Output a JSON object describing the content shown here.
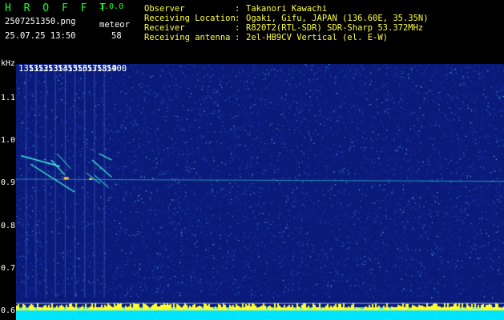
{
  "app": {
    "name": "H R O F F T",
    "version": "1.0.0"
  },
  "file": {
    "name": "2507251350.png",
    "datetime": "25.07.25 13:50"
  },
  "meteor": {
    "label": "meteor",
    "count": "58"
  },
  "info": [
    {
      "key": "Observer",
      "sep": ":",
      "value": "Takanori Kawachi"
    },
    {
      "key": "Receiving Location",
      "sep": ":",
      "value": "Ogaki, Gifu, JAPAN (136.60E, 35.35N)"
    },
    {
      "key": "Receiver",
      "sep": ":",
      "value": "R820T2(RTL-SDR) SDR-Sharp 53.372MHz"
    },
    {
      "key": "Receiving antenna",
      "sep": ":",
      "value": "2el-HB9CV Vertical (el. E-W)"
    }
  ],
  "chart_data": {
    "type": "heatmap",
    "ylabel": "kHz",
    "y_ticks": [
      "1.1",
      "1.0",
      "0.9",
      "0.8",
      "0.7",
      "0.6"
    ],
    "x_ticks": [
      "1351",
      "1352",
      "1353",
      "1354",
      "1355",
      "1356",
      "1357",
      "1358",
      "1359",
      "1400"
    ],
    "x_range": [
      1350,
      1400
    ],
    "y_range": [
      0.58,
      1.18
    ],
    "colors": {
      "background": "#0a1a7a",
      "trace": "#40ffe0",
      "hot": "#ffd040",
      "bottom_band": "#00e5ff",
      "bottom_peaks": "#ffff30"
    }
  }
}
